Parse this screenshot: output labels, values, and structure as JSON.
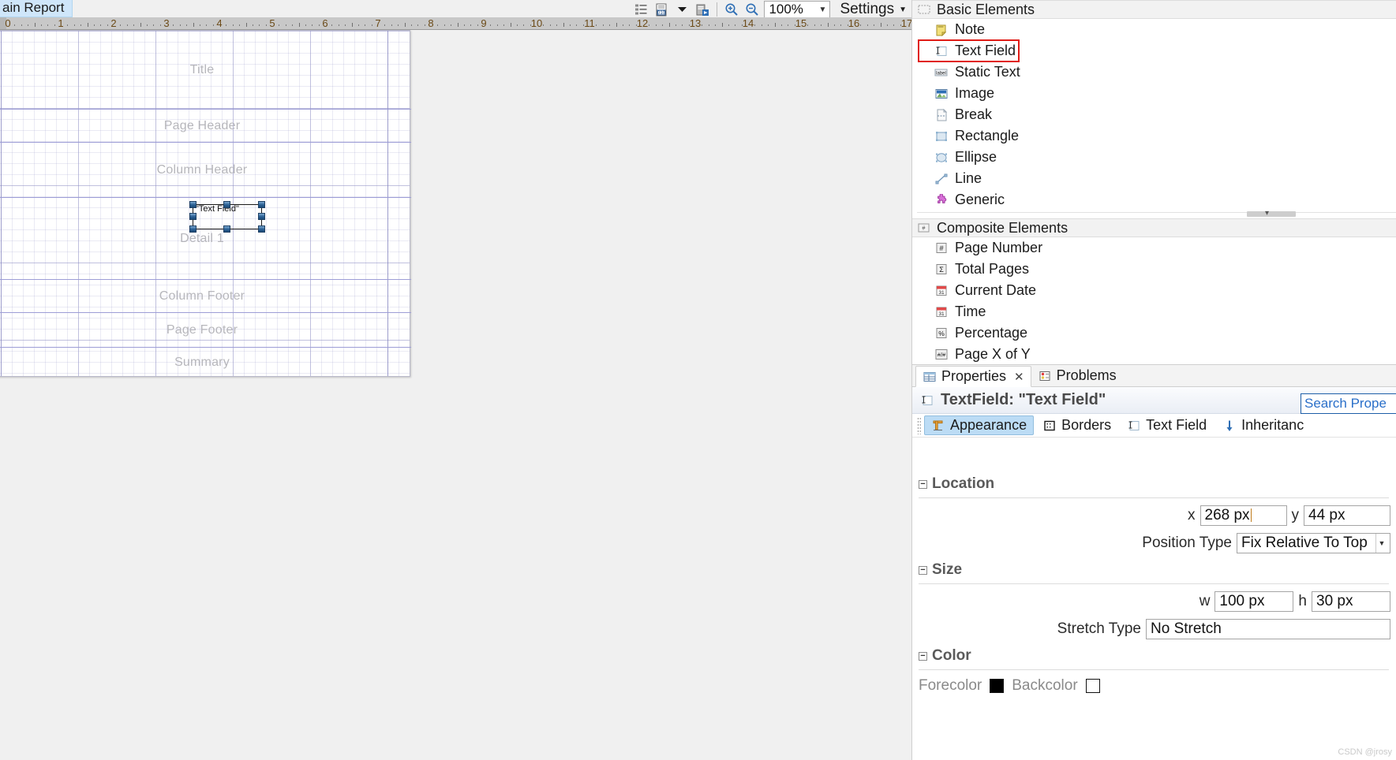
{
  "editor": {
    "tab_label": "ain Report",
    "zoom_value": "100%",
    "settings_label": "Settings",
    "toolbar_icons": [
      "list-icon",
      "numbered-document-icon",
      "dropdown-arrow-icon",
      "compile-report-icon",
      "zoom-in-icon",
      "zoom-out-icon"
    ],
    "ruler_marks": [
      "0",
      "1",
      "2",
      "3",
      "4",
      "5",
      "6",
      "7",
      "8",
      "9",
      "10",
      "11",
      "12",
      "13",
      "14",
      "15",
      "16",
      "17"
    ]
  },
  "canvas": {
    "bands": [
      {
        "label": "Title"
      },
      {
        "label": "Page Header"
      },
      {
        "label": "Column Header"
      },
      {
        "label": "Detail 1"
      },
      {
        "label": "Column Footer"
      },
      {
        "label": "Page Footer"
      },
      {
        "label": "Summary"
      }
    ],
    "selected_element": {
      "text": "\"Text Field\"",
      "name": "Text Field"
    }
  },
  "palette": {
    "groups": [
      {
        "title": "Basic Elements",
        "icon": "basic-elements-icon",
        "items": [
          {
            "label": "Note",
            "icon": "note-icon",
            "highlighted": false
          },
          {
            "label": "Text Field",
            "icon": "text-field-icon",
            "highlighted": true
          },
          {
            "label": "Static Text",
            "icon": "static-text-icon",
            "highlighted": false
          },
          {
            "label": "Image",
            "icon": "image-icon",
            "highlighted": false
          },
          {
            "label": "Break",
            "icon": "break-icon",
            "highlighted": false
          },
          {
            "label": "Rectangle",
            "icon": "rectangle-icon",
            "highlighted": false
          },
          {
            "label": "Ellipse",
            "icon": "ellipse-icon",
            "highlighted": false
          },
          {
            "label": "Line",
            "icon": "line-icon",
            "highlighted": false
          },
          {
            "label": "Generic",
            "icon": "generic-icon",
            "highlighted": false
          }
        ]
      },
      {
        "title": "Composite Elements",
        "icon": "composite-elements-icon",
        "items": [
          {
            "label": "Page Number",
            "icon": "page-number-icon",
            "highlighted": false
          },
          {
            "label": "Total Pages",
            "icon": "total-pages-icon",
            "highlighted": false
          },
          {
            "label": "Current Date",
            "icon": "current-date-icon",
            "highlighted": false
          },
          {
            "label": "Time",
            "icon": "time-icon",
            "highlighted": false
          },
          {
            "label": "Percentage",
            "icon": "percentage-icon",
            "highlighted": false
          },
          {
            "label": "Page X of Y",
            "icon": "page-x-of-y-icon",
            "highlighted": false
          }
        ]
      }
    ]
  },
  "properties": {
    "view_tabs": [
      {
        "label": "Properties",
        "icon": "properties-icon",
        "active": true,
        "closable": true
      },
      {
        "label": "Problems",
        "icon": "problems-icon",
        "active": false,
        "closable": false
      }
    ],
    "title": "TextField: \"Text Field\"",
    "search_placeholder": "Search Prope",
    "section_tabs": [
      {
        "label": "Appearance",
        "icon": "appearance-icon",
        "active": true
      },
      {
        "label": "Borders",
        "icon": "borders-icon",
        "active": false
      },
      {
        "label": "Text Field",
        "icon": "text-field-icon",
        "active": false
      },
      {
        "label": "Inheritanc",
        "icon": "inheritance-icon",
        "active": false
      }
    ],
    "groups": {
      "location": {
        "title": "Location",
        "x_label": "x",
        "x_value": "268 px",
        "y_label": "y",
        "y_value": "44 px",
        "position_type_label": "Position Type",
        "position_type_value": "Fix Relative To Top"
      },
      "size": {
        "title": "Size",
        "w_label": "w",
        "w_value": "100 px",
        "h_label": "h",
        "h_value": "30 px",
        "stretch_type_label": "Stretch Type",
        "stretch_type_value": "No Stretch"
      },
      "color": {
        "title": "Color",
        "forecolor_label": "Forecolor",
        "forecolor_value": "#000000",
        "backcolor_label": "Backcolor",
        "backcolor_value": "#ffffff"
      }
    }
  },
  "watermark": "CSDN @jrosy"
}
